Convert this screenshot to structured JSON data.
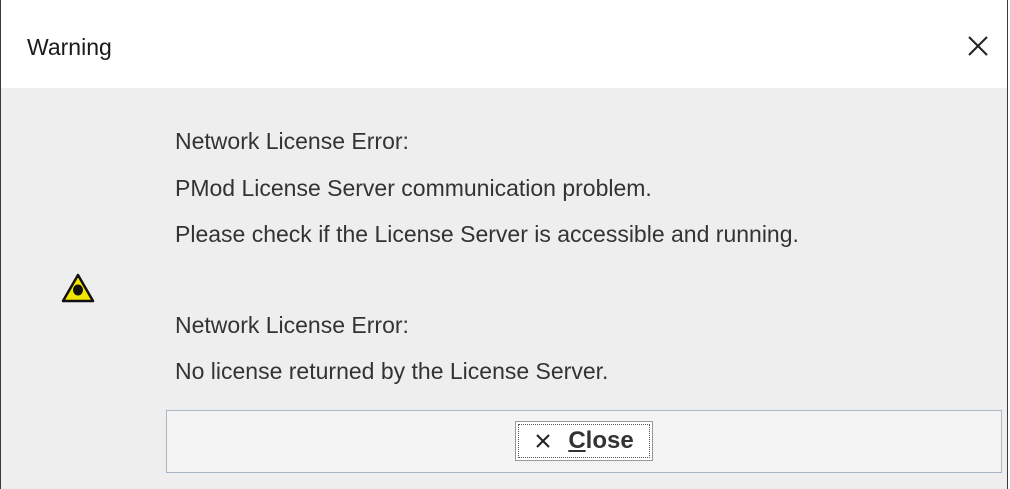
{
  "window": {
    "title": "Warning",
    "close_icon": "close-icon"
  },
  "message": {
    "icon": "warning-triangle-icon",
    "lines": [
      "Network License Error:",
      "PMod License Server communication problem.",
      "Please check if the License Server is accessible and running.",
      "Network License Error:",
      "No license returned by the License Server."
    ]
  },
  "buttons": {
    "close_icon": "x-icon",
    "close_mnemonic": "C",
    "close_rest": "lose"
  },
  "colors": {
    "content_background": "#eeeeee",
    "text": "#333333",
    "warning_yellow": "#f2e600"
  }
}
